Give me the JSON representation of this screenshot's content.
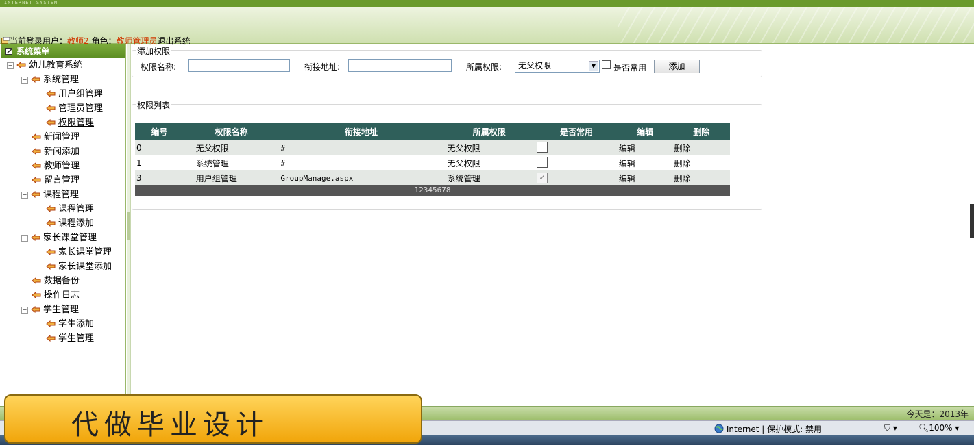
{
  "header": {
    "brand": "INTERNET SYSTEM"
  },
  "userbar": {
    "current_user_label": "当前登录用户：",
    "user": "教师2",
    "role_label": "角色：",
    "role": "教师管理员",
    "logout": "退出系统"
  },
  "sidebar": {
    "title": "系统菜单",
    "items": [
      {
        "label": "幼儿教育系统"
      },
      {
        "label": "系统管理"
      },
      {
        "label": "用户组管理"
      },
      {
        "label": "管理员管理"
      },
      {
        "label": "权限管理"
      },
      {
        "label": "新闻管理"
      },
      {
        "label": "新闻添加"
      },
      {
        "label": "教师管理"
      },
      {
        "label": "留言管理"
      },
      {
        "label": "课程管理"
      },
      {
        "label": "课程管理"
      },
      {
        "label": "课程添加"
      },
      {
        "label": "家长课堂管理"
      },
      {
        "label": "家长课堂管理"
      },
      {
        "label": "家长课堂添加"
      },
      {
        "label": "数据备份"
      },
      {
        "label": "操作日志"
      },
      {
        "label": "学生管理"
      },
      {
        "label": "学生添加"
      },
      {
        "label": "学生管理"
      }
    ]
  },
  "add_form": {
    "legend": "添加权限",
    "name_label": "权限名称:",
    "name_value": "",
    "url_label": "衔接地址:",
    "url_value": "",
    "parent_label": "所属权限:",
    "parent_selected": "无父权限",
    "common_label": "是否常用",
    "common_checked": false,
    "add_button": "添加"
  },
  "list": {
    "legend": "权限列表",
    "columns": [
      "编号",
      "权限名称",
      "衔接地址",
      "所属权限",
      "是否常用",
      "编辑",
      "删除"
    ],
    "rows": [
      {
        "id": "0",
        "name": "无父权限",
        "url": "#",
        "parent": "无父权限",
        "common": false,
        "edit": "编辑",
        "delete": "删除"
      },
      {
        "id": "1",
        "name": "系统管理",
        "url": "#",
        "parent": "无父权限",
        "common": false,
        "edit": "编辑",
        "delete": "删除"
      },
      {
        "id": "3",
        "name": "用户组管理",
        "url": "GroupManage.aspx",
        "parent": "系统管理",
        "common": true,
        "edit": "编辑",
        "delete": "删除"
      }
    ],
    "pager": "12345678"
  },
  "statusbar": {
    "today": "今天是：2013年"
  },
  "ie": {
    "zone": "Internet | 保护模式: 禁用",
    "zoom": "100%"
  },
  "banner": {
    "text": "代做毕业设计"
  },
  "colors": {
    "header_green": "#6a9a2c",
    "grid_header": "#2f5f5a",
    "user_red": "#d03800",
    "banner": "#f1a50a"
  }
}
